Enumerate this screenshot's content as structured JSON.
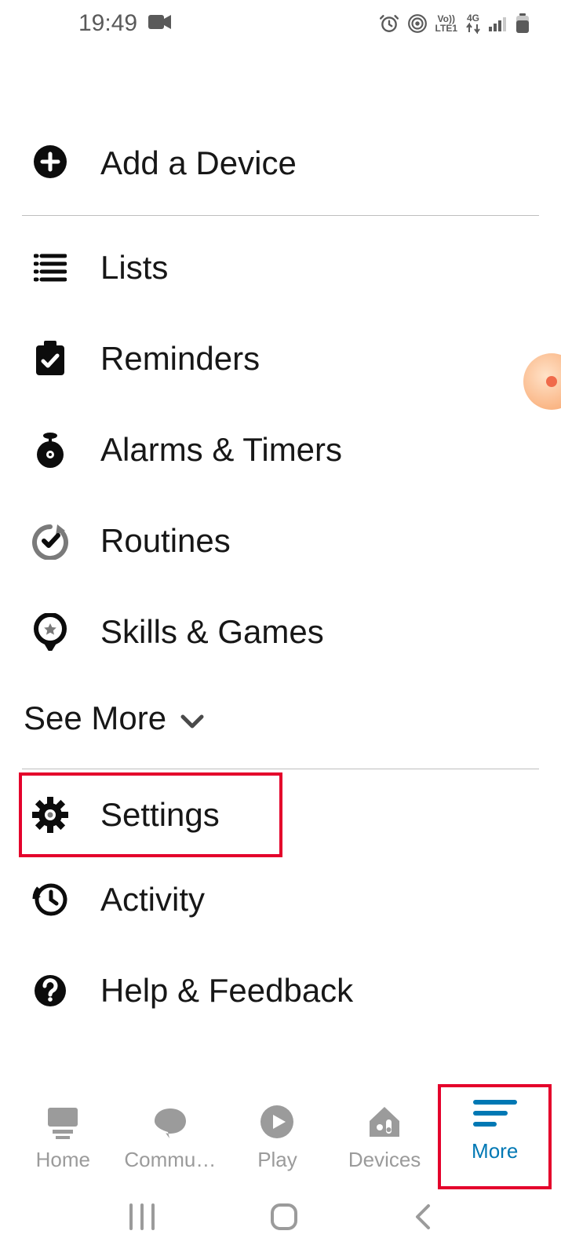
{
  "status": {
    "time": "19:49"
  },
  "menu": {
    "add_device": "Add a Device",
    "lists": "Lists",
    "reminders": "Reminders",
    "alarms": "Alarms & Timers",
    "routines": "Routines",
    "skills": "Skills & Games",
    "see_more": "See More",
    "settings": "Settings",
    "activity": "Activity",
    "help": "Help & Feedback"
  },
  "tabs": {
    "home": "Home",
    "communicate": "Commu…",
    "play": "Play",
    "devices": "Devices",
    "more": "More"
  },
  "network": {
    "volte": "Vo))",
    "lte": "LTE1",
    "gen": "4G"
  }
}
